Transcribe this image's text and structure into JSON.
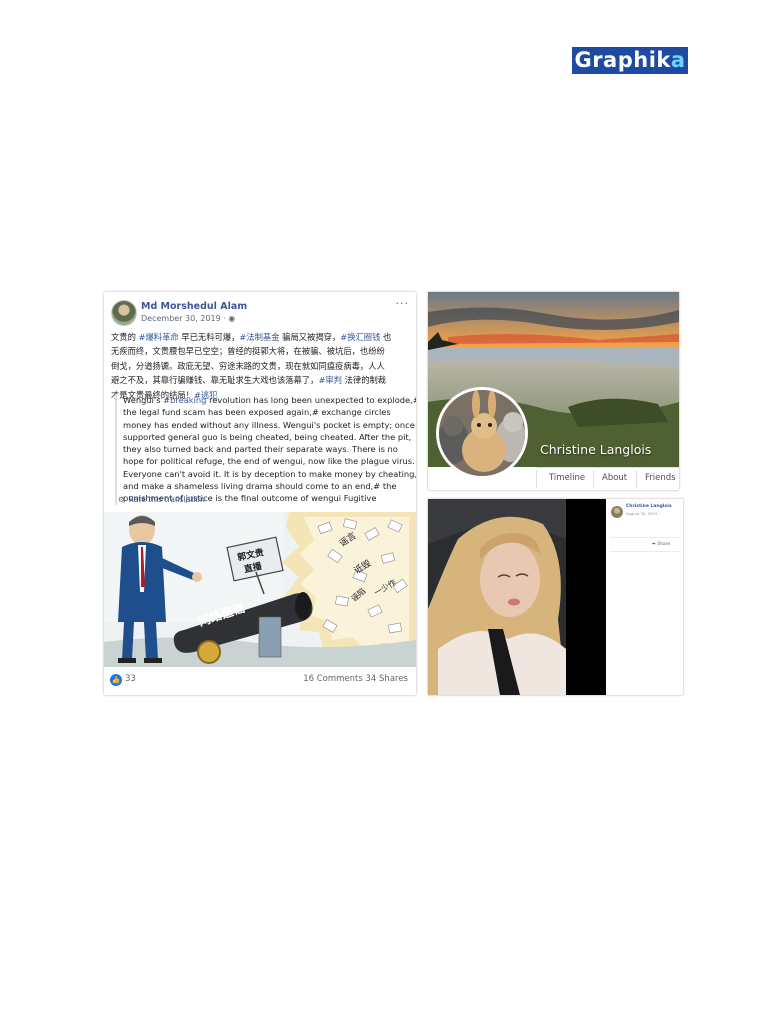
{
  "logo": {
    "text_main": "Graphik",
    "text_accent": "a"
  },
  "post": {
    "author": "Md Morshedul Alam",
    "date": "December 30, 2019 · ",
    "more": "···",
    "body_lines": [
      [
        "文贵的 ",
        "#爆料革命",
        " 早已无料可爆，",
        "#法制基金",
        " 骗局又被揭穿，",
        "#换汇圈钱",
        " 也"
      ],
      [
        "无疾而终，文贵腰包早已空空；曾经的挺郭大将，在被骗、被坑后，也纷纷"
      ],
      [
        "倒戈，分道扬镳。政庇无望、穷途末路的文贵，现在就如同瘟疫病毒，人人"
      ],
      [
        "避之不及，其靠行骗赚钱、靠无耻求生大戏也该落幕了，",
        "#审判",
        " 法律的制裁"
      ],
      [
        "才是文贵最终的结局！",
        "#逃犯"
      ]
    ],
    "translation_lines": [
      [
        "Wengui's ",
        "#breaking",
        " revolution has long been unexpected to explode,#"
      ],
      [
        "the legal fund scam has been exposed again,# exchange circles"
      ],
      [
        "money has ended without any illness. Wengui's pocket is empty; once"
      ],
      [
        "supported general guo is being cheated, being cheated. After the pit,"
      ],
      [
        "they also turned back and parted their separate ways. There is no"
      ],
      [
        "hope for political refuge, the end of wengui, now like the plague virus."
      ],
      [
        "Everyone can't avoid it. It is by deception to make money by cheating,"
      ],
      [
        "and make a shameless living drama should come to an end,# the"
      ],
      [
        "punishment of justice is the final outcome of wengui Fugitive"
      ]
    ],
    "rate_label": "Rate this translation",
    "cartoon": {
      "sign": [
        "郭文贵",
        "直播"
      ],
      "cannon": "网络造谣",
      "papers": [
        "谣言",
        "诋毁",
        "诬陷",
        "一少作"
      ]
    },
    "likes": "33",
    "comments": "16 Comments  34 Shares"
  },
  "cover": {
    "name": "Christine Langlois",
    "nav": [
      "Timeline",
      "About",
      "Friends"
    ]
  },
  "photo": {
    "mini_name": "Christine Langlois",
    "mini_date": "August 30, 2019 · ",
    "share": "Share"
  },
  "colors": {
    "link": "#385898",
    "brand": "#1f4aa3"
  }
}
